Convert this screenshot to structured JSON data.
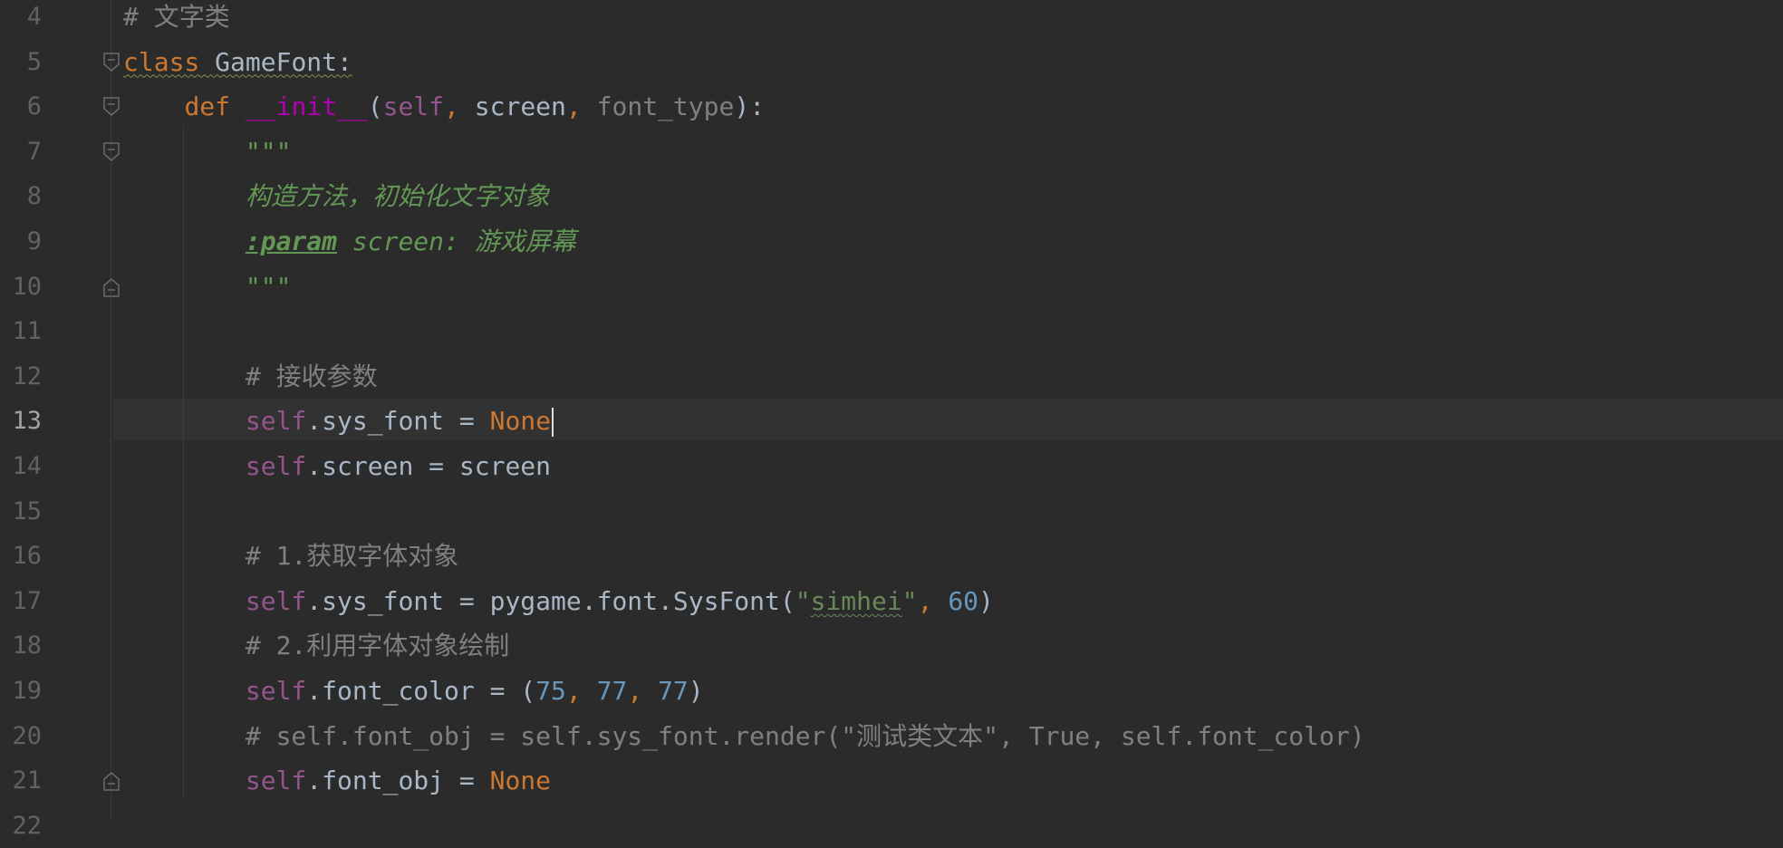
{
  "editor": {
    "language": "Python",
    "current_line": "13",
    "lines": [
      {
        "num": "4",
        "tokens": [
          {
            "t": "# 文字类",
            "c": "com"
          }
        ]
      },
      {
        "num": "5",
        "tokens": [
          {
            "t": "class",
            "c": "kw cls"
          },
          {
            "t": " GameFont:",
            "c": "cls"
          }
        ]
      },
      {
        "num": "6",
        "tokens": [
          {
            "t": "    ",
            "c": ""
          },
          {
            "t": "def",
            "c": "kw"
          },
          {
            "t": " ",
            "c": ""
          },
          {
            "t": "__init__",
            "c": "dunder"
          },
          {
            "t": "(",
            "c": ""
          },
          {
            "t": "self",
            "c": "self"
          },
          {
            "t": ", ",
            "c": "kw"
          },
          {
            "t": "screen",
            "c": ""
          },
          {
            "t": ", ",
            "c": "kw"
          },
          {
            "t": "font_type",
            "c": "param"
          },
          {
            "t": "):",
            "c": ""
          }
        ]
      },
      {
        "num": "7",
        "tokens": [
          {
            "t": "        ",
            "c": ""
          },
          {
            "t": "\"\"\"",
            "c": "doc"
          }
        ]
      },
      {
        "num": "8",
        "tokens": [
          {
            "t": "        ",
            "c": ""
          },
          {
            "t": "构造方法，初始化文字对象",
            "c": "doc"
          }
        ]
      },
      {
        "num": "9",
        "tokens": [
          {
            "t": "        ",
            "c": ""
          },
          {
            "t": ":param",
            "c": "doctag"
          },
          {
            "t": " screen: 游戏屏幕",
            "c": "doc"
          }
        ]
      },
      {
        "num": "10",
        "tokens": [
          {
            "t": "        ",
            "c": ""
          },
          {
            "t": "\"\"\"",
            "c": "doc"
          }
        ]
      },
      {
        "num": "11",
        "tokens": []
      },
      {
        "num": "12",
        "tokens": [
          {
            "t": "        ",
            "c": ""
          },
          {
            "t": "# 接收参数",
            "c": "com"
          }
        ]
      },
      {
        "num": "13",
        "tokens": [
          {
            "t": "        ",
            "c": ""
          },
          {
            "t": "self",
            "c": "self"
          },
          {
            "t": ".sys_font = ",
            "c": ""
          },
          {
            "t": "None",
            "c": "kw"
          }
        ]
      },
      {
        "num": "14",
        "tokens": [
          {
            "t": "        ",
            "c": ""
          },
          {
            "t": "self",
            "c": "self"
          },
          {
            "t": ".screen = screen",
            "c": ""
          }
        ]
      },
      {
        "num": "15",
        "tokens": []
      },
      {
        "num": "16",
        "tokens": [
          {
            "t": "        ",
            "c": ""
          },
          {
            "t": "# 1.获取字体对象",
            "c": "com"
          }
        ]
      },
      {
        "num": "17",
        "tokens": [
          {
            "t": "        ",
            "c": ""
          },
          {
            "t": "self",
            "c": "self"
          },
          {
            "t": ".sys_font = pygame.font.SysFont(",
            "c": ""
          },
          {
            "t": "\"",
            "c": "str"
          },
          {
            "t": "simhei",
            "c": "str squig"
          },
          {
            "t": "\"",
            "c": "str"
          },
          {
            "t": ", ",
            "c": "kw"
          },
          {
            "t": "60",
            "c": "num"
          },
          {
            "t": ")",
            "c": ""
          }
        ]
      },
      {
        "num": "18",
        "tokens": [
          {
            "t": "        ",
            "c": ""
          },
          {
            "t": "# 2.利用字体对象绘制",
            "c": "com"
          }
        ]
      },
      {
        "num": "19",
        "tokens": [
          {
            "t": "        ",
            "c": ""
          },
          {
            "t": "self",
            "c": "self"
          },
          {
            "t": ".font_color = (",
            "c": ""
          },
          {
            "t": "75",
            "c": "num"
          },
          {
            "t": ", ",
            "c": "kw"
          },
          {
            "t": "77",
            "c": "num"
          },
          {
            "t": ", ",
            "c": "kw"
          },
          {
            "t": "77",
            "c": "num"
          },
          {
            "t": ")",
            "c": ""
          }
        ]
      },
      {
        "num": "20",
        "tokens": [
          {
            "t": "        ",
            "c": ""
          },
          {
            "t": "# self.font_obj = self.sys_font.render(\"测试类文本\", True, self.font_color)",
            "c": "com"
          }
        ]
      },
      {
        "num": "21",
        "tokens": [
          {
            "t": "        ",
            "c": ""
          },
          {
            "t": "self",
            "c": "self"
          },
          {
            "t": ".font_obj = ",
            "c": ""
          },
          {
            "t": "None",
            "c": "kw"
          }
        ]
      },
      {
        "num": "22",
        "tokens": []
      }
    ],
    "fold_markers": [
      {
        "line": "5",
        "icon": "fold-open-icon"
      },
      {
        "line": "6",
        "icon": "fold-open-icon"
      },
      {
        "line": "7",
        "icon": "fold-open-icon"
      },
      {
        "line": "10",
        "icon": "fold-end-icon"
      },
      {
        "line": "21",
        "icon": "fold-end-icon"
      }
    ],
    "colors": {
      "background": "#2b2b2b",
      "keyword": "#cc7832",
      "self": "#94558d",
      "comment": "#808080",
      "docstring": "#629755",
      "string": "#6a8759",
      "number": "#6897bb"
    }
  }
}
